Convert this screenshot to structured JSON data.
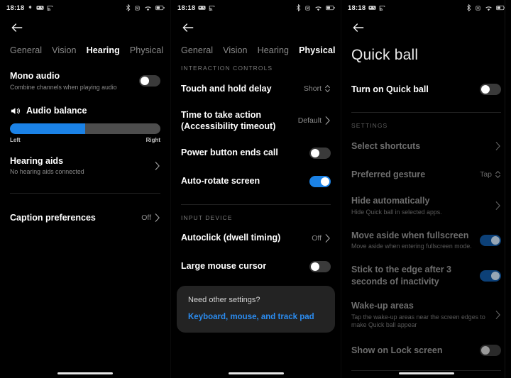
{
  "theme": {
    "background": "#000000",
    "accent": "#1b82e6",
    "accent_dim": "#0c4077",
    "link": "#2b8cf0"
  },
  "statusbar": {
    "time": "18:18",
    "left_icons": [
      "dnd-icon",
      "game-controller-icon",
      "cast-icon"
    ],
    "left_icons_panel2": [
      "game-controller-icon",
      "cast-icon"
    ],
    "right_icons": [
      "bluetooth-icon",
      "vibrate-icon",
      "wifi-icon",
      "battery-icon"
    ]
  },
  "panel1": {
    "back_label": "Back",
    "tabs": [
      {
        "label": "General",
        "active": false
      },
      {
        "label": "Vision",
        "active": false
      },
      {
        "label": "Hearing",
        "active": true
      },
      {
        "label": "Physical",
        "active": false
      }
    ],
    "mono_audio": {
      "title": "Mono audio",
      "subtitle": "Combine channels when playing audio",
      "toggle": "off"
    },
    "audio_balance": {
      "title": "Audio balance",
      "icon": "speaker-icon",
      "fill_percent": 50,
      "left_label": "Left",
      "right_label": "Right"
    },
    "hearing_aids": {
      "title": "Hearing aids",
      "subtitle": "No hearing aids connected"
    },
    "caption_preferences": {
      "title": "Caption preferences",
      "value": "Off"
    }
  },
  "panel2": {
    "tabs": [
      {
        "label": "General",
        "active": false
      },
      {
        "label": "Vision",
        "active": false
      },
      {
        "label": "Hearing",
        "active": false
      },
      {
        "label": "Physical",
        "active": true
      }
    ],
    "section_interaction": "INTERACTION CONTROLS",
    "touch_hold_delay": {
      "title": "Touch and hold delay",
      "value": "Short"
    },
    "time_to_take_action": {
      "title": "Time to take action\n(Accessibility timeout)",
      "title_line1": "Time to take action",
      "title_line2": "(Accessibility timeout)",
      "value": "Default"
    },
    "power_button_ends_call": {
      "title": "Power button ends call",
      "toggle": "off"
    },
    "auto_rotate_screen": {
      "title": "Auto-rotate screen",
      "toggle": "on"
    },
    "section_input": "INPUT DEVICE",
    "autoclick": {
      "title": "Autoclick (dwell timing)",
      "value": "Off"
    },
    "large_mouse_cursor": {
      "title": "Large mouse cursor",
      "toggle": "off"
    },
    "card": {
      "question": "Need other settings?",
      "link": "Keyboard, mouse, and track pad"
    }
  },
  "panel3": {
    "page_title": "Quick ball",
    "turn_on": {
      "title": "Turn on Quick ball",
      "toggle": "off"
    },
    "section_settings": "SETTINGS",
    "select_shortcuts": {
      "title": "Select shortcuts"
    },
    "preferred_gesture": {
      "title": "Preferred gesture",
      "value": "Tap"
    },
    "hide_automatically": {
      "title": "Hide automatically",
      "subtitle": "Hide Quick ball in selected apps."
    },
    "move_aside": {
      "title": "Move aside when fullscreen",
      "subtitle": "Move aside when entering fullscreen mode.",
      "toggle": "on-dim"
    },
    "stick_to_edge": {
      "title": "Stick to the edge after 3 seconds of inactivity",
      "toggle": "on-dim"
    },
    "wake_up_areas": {
      "title": "Wake-up areas",
      "subtitle": "Tap the wake-up areas near the screen edges to make Quick ball appear"
    },
    "show_on_lock": {
      "title": "Show on Lock screen",
      "toggle": "off-dim"
    }
  }
}
